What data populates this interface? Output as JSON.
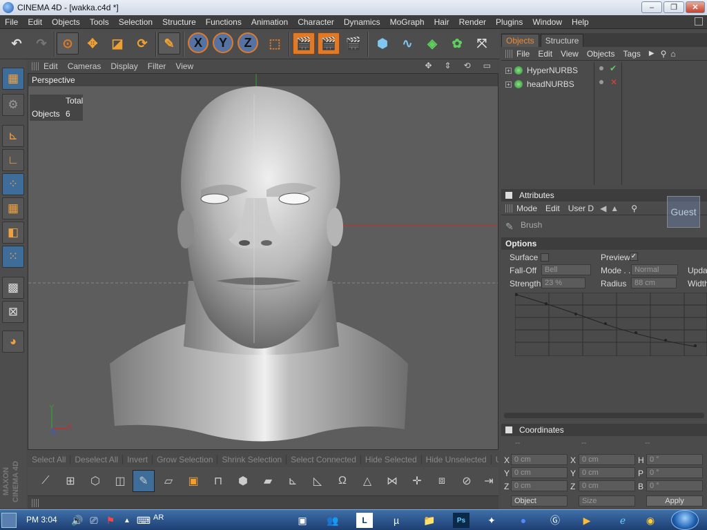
{
  "window": {
    "title": "CINEMA 4D - [wakka.c4d *]",
    "min": "‒",
    "max": "❐",
    "close": "✕"
  },
  "menu": [
    "File",
    "Edit",
    "Objects",
    "Tools",
    "Selection",
    "Structure",
    "Functions",
    "Animation",
    "Character",
    "Dynamics",
    "MoGraph",
    "Hair",
    "Render",
    "Plugins",
    "Window",
    "Help"
  ],
  "toolbar": {
    "x_label": "X",
    "y_label": "Y",
    "z_label": "Z"
  },
  "viewport": {
    "menu": [
      "Edit",
      "Cameras",
      "Display",
      "Filter",
      "View"
    ],
    "name": "Perspective",
    "hud_header": "Total",
    "hud_label": "Objects",
    "hud_value": "6",
    "axis_x": "X",
    "axis_y": "Y",
    "axis_z": "Z"
  },
  "objects_panel": {
    "tabs": [
      "Objects",
      "Structure"
    ],
    "menu": [
      "File",
      "Edit",
      "View",
      "Objects",
      "Tags"
    ],
    "items": [
      {
        "name": "HyperNURBS",
        "expand": "+",
        "status": "✔"
      },
      {
        "name": "headNURBS",
        "expand": "+",
        "status": "✕"
      }
    ]
  },
  "attributes_panel": {
    "title": "Attributes",
    "menu": [
      "Mode",
      "Edit",
      "User D"
    ],
    "tool": "Brush",
    "section": "Options",
    "surface_label": "Surface",
    "preview_label": "Preview",
    "preview_check": "✓",
    "falloff_label": "Fall-Off",
    "falloff_value": "Bell",
    "mode_label": "Mode . .",
    "mode_value": "Normal",
    "update_label": "Upda",
    "strength_label": "Strength",
    "strength_value": "23 %",
    "radius_label": "Radius",
    "radius_value": "88 cm",
    "width_label": "Width",
    "watermark": "Guest"
  },
  "coordinates_panel": {
    "title": "Coordinates",
    "col_placeholder": "--",
    "rows": [
      {
        "a": "X",
        "av": "0 cm",
        "b": "X",
        "bv": "0 cm",
        "c": "H",
        "cv": "0 °"
      },
      {
        "a": "Y",
        "av": "0 cm",
        "b": "Y",
        "bv": "0 cm",
        "c": "P",
        "cv": "0 °"
      },
      {
        "a": "Z",
        "av": "0 cm",
        "b": "Z",
        "bv": "0 cm",
        "c": "B",
        "cv": "0 °"
      }
    ],
    "object_dropdown": "Object",
    "size_dropdown": "Size",
    "apply": "Apply"
  },
  "selection_bar": [
    "Select All",
    "Deselect All",
    "Invert",
    "Grow Selection",
    "Shrink Selection",
    "Select Connected",
    "Hide Selected",
    "Hide Unselected",
    "Unhide All"
  ],
  "sidebar_brand": "MAXON CINEMA 4D",
  "taskbar": {
    "time": "PM 3:04",
    "lang": "AR"
  }
}
